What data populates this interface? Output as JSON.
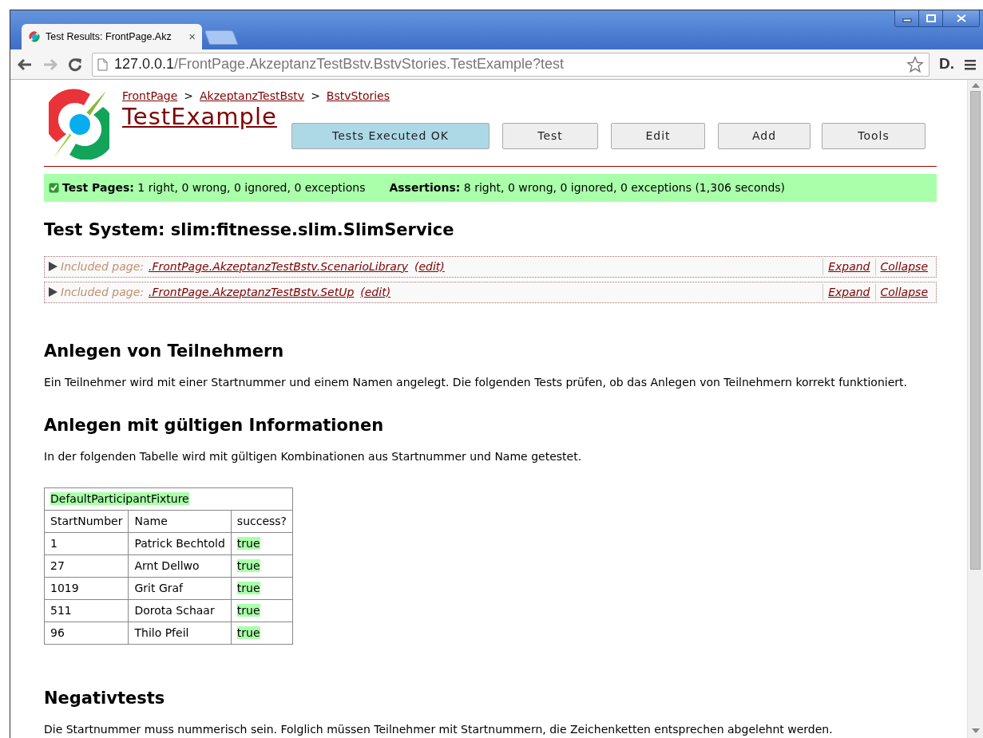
{
  "browser": {
    "tab_title": "Test Results: FrontPage.Akz",
    "tab_close": "×",
    "url_host": "127.0.0.1",
    "url_path": "/FrontPage.AkzeptanzTestBstv.BstvStories.TestExample?test",
    "extension_label": "D."
  },
  "breadcrumbs": [
    "FrontPage",
    "AkzeptanzTestBstv",
    "BstvStories"
  ],
  "breadcrumb_separator": ">",
  "page_title": "TestExample",
  "buttons": [
    {
      "label": "Tests Executed OK",
      "kind": "status"
    },
    {
      "label": "Test",
      "kind": "action"
    },
    {
      "label": "Edit",
      "kind": "action"
    },
    {
      "label": "Add",
      "kind": "action"
    },
    {
      "label": "Tools",
      "kind": "action"
    }
  ],
  "summary": {
    "passed": true,
    "parts": [
      "**Test Pages:** 1 right, 0 wrong, 0 ignored, 0 exceptions",
      "**Assertions:** 8 right, 0 wrong, 0 ignored, 0 exceptions (1,306 seconds)"
    ]
  },
  "test_system": "Test System: slim:fitnesse.slim.SlimService",
  "included_pages": [
    {
      "expanded": false,
      "label": "Included page:",
      "link": ".FrontPage.AkzeptanzTestBstv.ScenarioLibrary",
      "edit": "(edit)",
      "expand": "Expand",
      "collapse": "Collapse"
    },
    {
      "expanded": false,
      "label": "Included page:",
      "link": ".FrontPage.AkzeptanzTestBstv.SetUp",
      "edit": "(edit)",
      "expand": "Expand",
      "collapse": "Collapse"
    }
  ],
  "sections": [
    {
      "heading": "Anlegen von Teilnehmern",
      "text": "Ein Teilnehmer wird mit einer Startnummer und einem Namen angelegt. Die folgenden Tests prüfen, ob das Anlegen von Teilnehmern korrekt funktioniert."
    },
    {
      "heading": "Anlegen mit gültigen Informationen",
      "text": "In der folgenden Tabelle wird mit gültigen Kombinationen aus Startnummer und Name getestet.",
      "table": {
        "title": "DefaultParticipantFixture",
        "title_passed": true,
        "columns": [
          "StartNumber",
          "Name",
          "success?"
        ],
        "rows": [
          {
            "cells": [
              "1",
              "Patrick Bechtold",
              "true"
            ],
            "passed": true
          },
          {
            "cells": [
              "27",
              "Arnt Dellwo",
              "true"
            ],
            "passed": true
          },
          {
            "cells": [
              "1019",
              "Grit Graf",
              "true"
            ],
            "passed": true
          },
          {
            "cells": [
              "511",
              "Dorota Schaar",
              "true"
            ],
            "passed": true
          },
          {
            "cells": [
              "96",
              "Thilo Pfeil",
              "true"
            ],
            "passed": true
          }
        ]
      }
    },
    {
      "heading": "Negativtests",
      "text": "Die Startnummer muss nummerisch sein. Folglich müssen Teilnehmer mit Startnummern, die Zeichenketten entsprechen abgelehnt werden."
    }
  ]
}
